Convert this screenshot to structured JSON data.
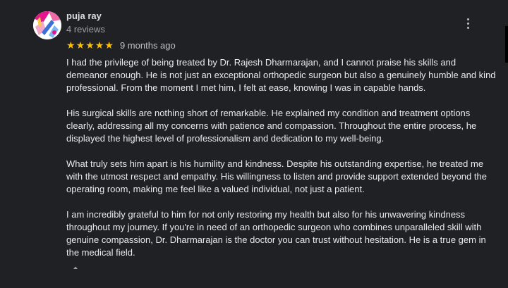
{
  "review": {
    "author": "puja ray",
    "review_count": "4 reviews",
    "rating": 5,
    "rating_max": 5,
    "date": "9 months ago",
    "paragraphs": [
      "I had the privilege of being treated by Dr. Rajesh Dharmarajan, and I cannot praise his skills and demeanor enough. He is not just an exceptional orthopedic surgeon but also a genuinely humble and kind professional. From the moment I met him, I felt at ease, knowing I was in capable hands.",
      "His surgical skills are nothing short of remarkable. He explained my condition and treatment options clearly, addressing all my concerns with patience and compassion. Throughout the entire process, he displayed the highest level of professionalism and dedication to my well-being.",
      "What truly sets him apart is his humility and kindness. Despite his outstanding expertise, he treated me with the utmost respect and empathy. His willingness to listen and provide support extended beyond the operating room, making me feel like a valued individual, not just a patient.",
      "I am incredibly grateful to him for not only restoring my health but also for his unwavering kindness throughout my journey. If you're in need of an orthopedic surgeon who combines unparalleled skill with genuine compassion, Dr. Dharmarajan is the doctor you can trust without hesitation. He is a true gem in the medical field."
    ]
  },
  "icons": {
    "avatar": "avatar-illustration",
    "star": "star-icon",
    "more": "more-vert-icon",
    "collapse": "collapse-caret-icon"
  },
  "colors": {
    "background": "#202124",
    "text": "#e8eaed",
    "muted": "#9aa0a6",
    "star": "#fbbc04"
  }
}
